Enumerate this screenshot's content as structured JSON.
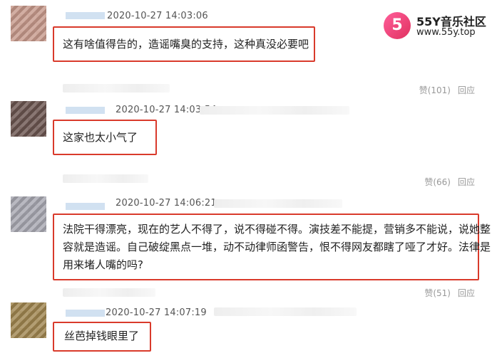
{
  "watermark": {
    "badge": "5",
    "title": "55Y音乐社区",
    "url": "www.55y.top"
  },
  "comments": [
    {
      "timestamp": "2020-10-27 14:03:06",
      "text": "这有啥值得告的，造谣嘴臭的支持，这种真没必要吧",
      "like_label": "赞",
      "likes": "(101)",
      "reply_label": "回应",
      "avatar_color": "#c79a8c"
    },
    {
      "timestamp": "2020-10-27 14:03:54",
      "text": "这家也太小气了",
      "like_label": "赞",
      "likes": "(66)",
      "reply_label": "回应",
      "avatar_color": "#6b5550"
    },
    {
      "timestamp": "2020-10-27 14:06:21",
      "text_lines": [
        "法院干得漂亮，现在的艺人不得了，说不得碰不得。演技差不能提，营销多不能说，说她整",
        "容就是造谣。自己破绽黑点一堆，动不动律师函警告，恨不得网友都瞎了哑了才好。法律是",
        "用来堵人嘴的吗?"
      ],
      "like_label": "赞",
      "likes": "(51)",
      "reply_label": "回应",
      "avatar_color": "#a8a8b2"
    },
    {
      "timestamp": "2020-10-27 14:07:19",
      "text": "丝芭掉钱眼里了",
      "avatar_color": "#a08650"
    }
  ]
}
